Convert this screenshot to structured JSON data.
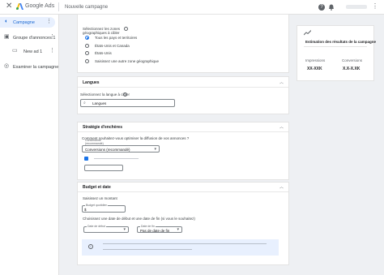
{
  "app": {
    "brand": "Google Ads",
    "page_title": "Nouvelle campagne"
  },
  "icons": {
    "close": "close-icon",
    "help": "help-icon",
    "bell": "notifications-icon",
    "more": "more-vert-icon"
  },
  "sidebar": {
    "items": [
      {
        "label": "Campagne"
      },
      {
        "label": "Groupe d'annonces 1"
      },
      {
        "label": "New ad 1"
      },
      {
        "label": "Examiner la campagne"
      }
    ]
  },
  "locations": {
    "label": "Sélectionnez les zones géographiques à cibler",
    "options": [
      "Tous les pays et territoires",
      "États-Unis et Canada",
      "États-Unis",
      "Saisissez une autre zone géographique"
    ],
    "selected_index": 0
  },
  "languages": {
    "header": "Langues",
    "label": "Sélectionnez la langue à cibler",
    "value": "Langues"
  },
  "bidding": {
    "header": "Stratégie d'enchères",
    "question": "Comment souhaitez-vous optimiser la diffusion de vos annonces ?",
    "field_label": "Conversions (recommandé)",
    "value": "Conversions (recommandé)"
  },
  "budget": {
    "header": "Budget et date",
    "amount_label": "Saisissez un montant",
    "daily_label": "Budget quotidien",
    "currency": "$",
    "dates_label": "Choisissez une date de début et une date de fin (si vous le souhaitez)",
    "start_label": "Date de début",
    "end_label": "Date de fin",
    "end_value": "Pas de date de fin"
  },
  "estimate": {
    "title": "Estimation des résultats de la campagne",
    "impressions_label": "Impressions",
    "conversions_label": "Conversions",
    "impressions_value": "XX-XXK",
    "conversions_value": "X.X-X.XK"
  },
  "colors": {
    "accent": "#1a73e8",
    "selected_bg": "#e8f0fe",
    "info_bg": "#e8f0fe"
  }
}
